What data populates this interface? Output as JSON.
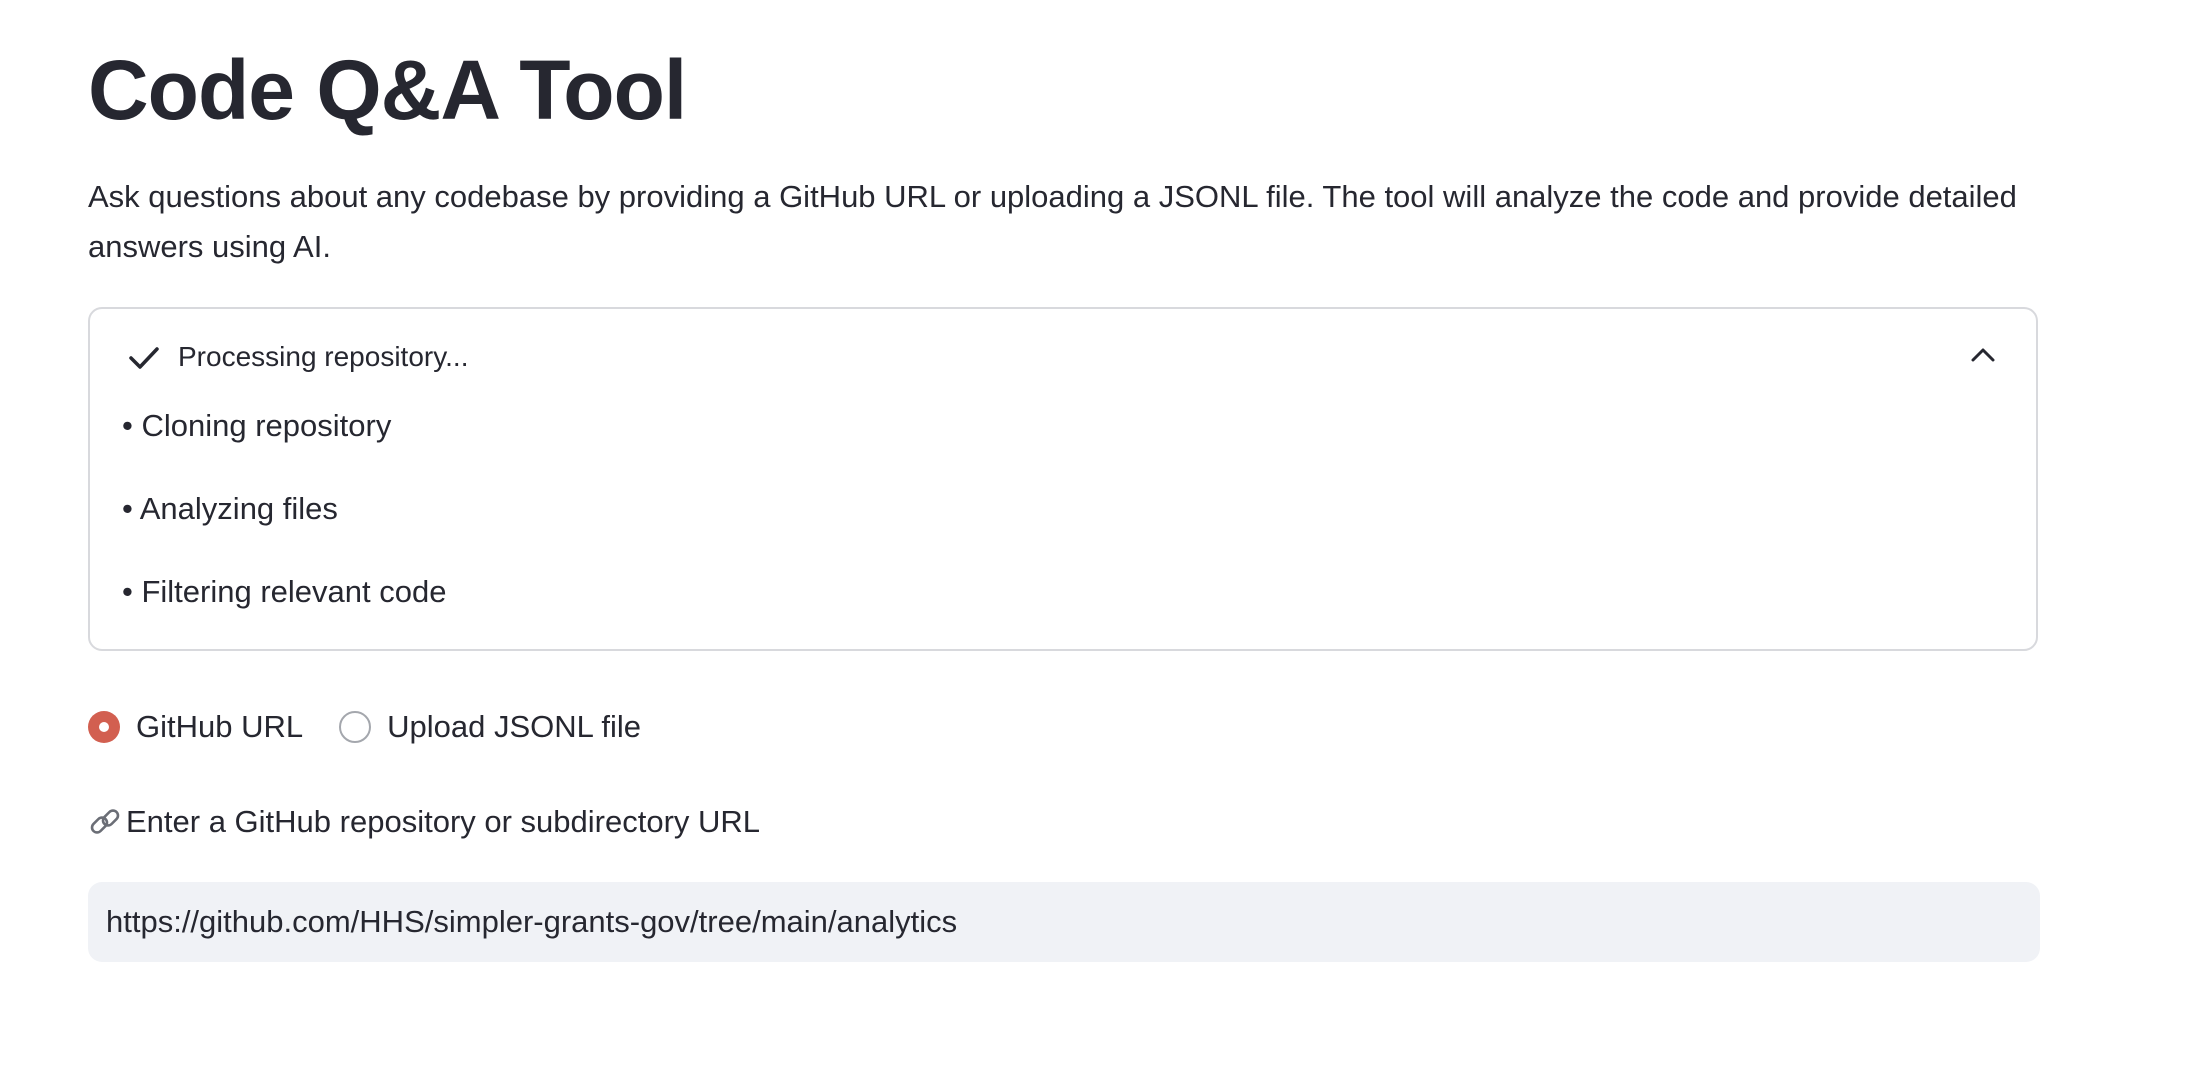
{
  "page": {
    "title": "Code Q&A Tool",
    "description": "Ask questions about any codebase by providing a GitHub URL or uploading a JSONL file. The tool will analyze the code and provide detailed answers using AI."
  },
  "status_panel": {
    "title": "Processing repository...",
    "state": "complete",
    "expanded": true,
    "check_icon": "check-icon",
    "toggle_icon": "chevron-up-icon",
    "steps": [
      "• Cloning repository",
      "• Analyzing files",
      "• Filtering relevant code"
    ]
  },
  "source_options": {
    "options": [
      {
        "label": "GitHub URL",
        "selected": true
      },
      {
        "label": "Upload JSONL file",
        "selected": false
      }
    ],
    "accent_color": "#d25f50"
  },
  "url_field": {
    "icon": "link-icon",
    "label": "Enter a GitHub repository or subdirectory URL",
    "value": "https://github.com/HHS/simpler-grants-gov/tree/main/analytics"
  }
}
